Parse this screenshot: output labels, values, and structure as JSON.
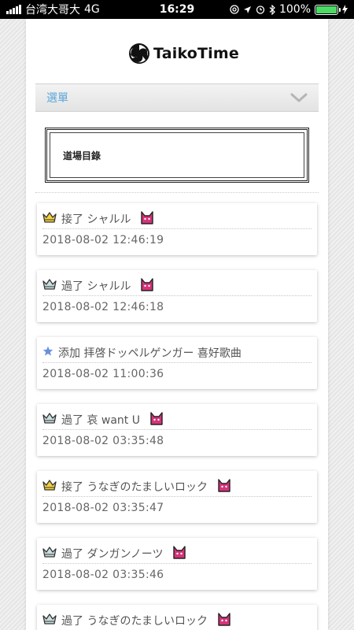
{
  "status_bar": {
    "carrier": "台湾大哥大",
    "network": "4G",
    "time": "16:29",
    "battery": "100%"
  },
  "header": {
    "logo_text": "TaikoTime"
  },
  "menu": {
    "label": "選單"
  },
  "dojo": {
    "label": "道場目錄"
  },
  "colors": {
    "menu_label": "#5aa7d8",
    "crown_gold": "#f4d03f",
    "crown_silver": "#c9dede",
    "cat_pink": "#d6337a",
    "star_blue": "#6b8fe0"
  },
  "activities": [
    {
      "icon": "gold-crown-icon",
      "text": "接了 シャルル",
      "badge": "oni-cat-icon",
      "time": "2018-08-02 12:46:19"
    },
    {
      "icon": "silver-crown-icon",
      "text": "過了 シャルル",
      "badge": "oni-cat-icon",
      "time": "2018-08-02 12:46:18"
    },
    {
      "icon": "star-icon",
      "text": "添加 拝啓ドッペルゲンガー 喜好歌曲",
      "badge": "",
      "time": "2018-08-02 11:00:36"
    },
    {
      "icon": "silver-crown-icon",
      "text": "過了 哀 want U",
      "badge": "oni-cat-icon",
      "time": "2018-08-02 03:35:48"
    },
    {
      "icon": "gold-crown-icon",
      "text": "接了 うなぎのたましいロック",
      "badge": "oni-cat-icon",
      "time": "2018-08-02 03:35:47"
    },
    {
      "icon": "silver-crown-icon",
      "text": "過了 ダンガンノーツ",
      "badge": "oni-cat-icon",
      "time": "2018-08-02 03:35:46"
    },
    {
      "icon": "silver-crown-icon",
      "text": "過了 うなぎのたましいロック",
      "badge": "oni-cat-icon",
      "time": ""
    }
  ]
}
